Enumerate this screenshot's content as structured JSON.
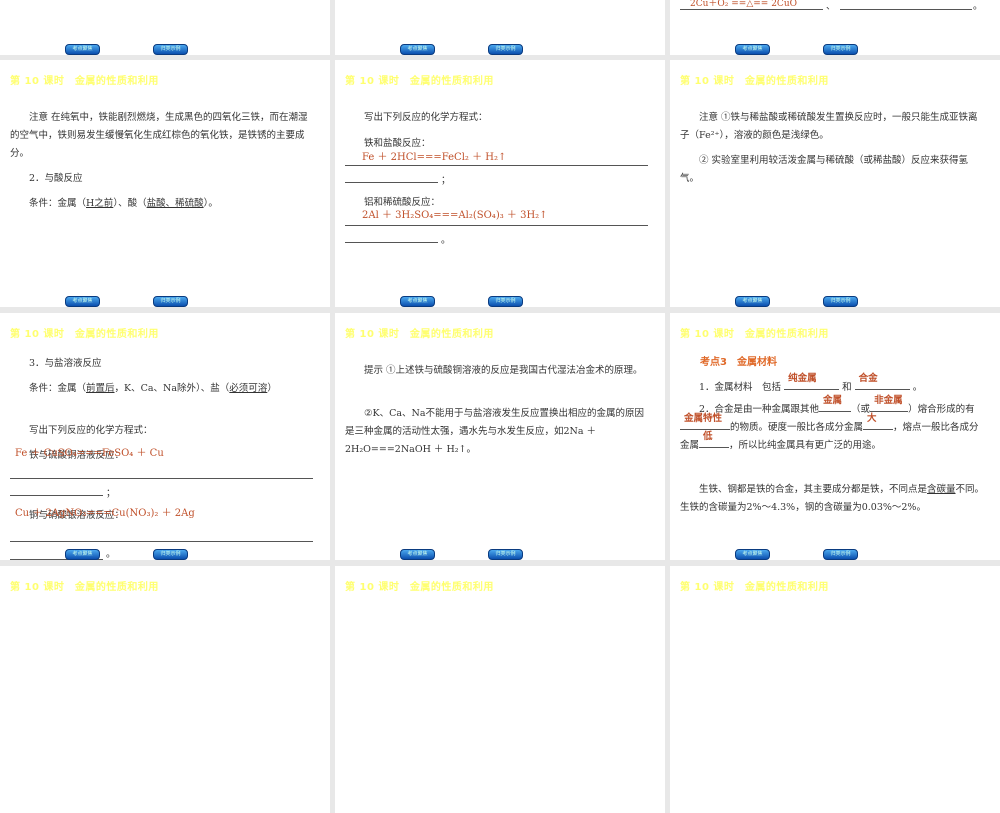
{
  "slide_title": "第 10 课时　金属的性质和利用",
  "nav": {
    "prev_label": "考点聚焦",
    "next_label": "归类示例"
  },
  "s0": {
    "answer": "2Cu＋O₂ ==△== 2CuO",
    "sep": "、",
    "end": "。"
  },
  "s1": {
    "p1": "注意 在纯氧中，铁能剧烈燃烧，生成黑色的四氧化三铁，而在潮湿的空气中，铁则易发生缓慢氧化生成红棕色的氧化铁，是铁锈的主要成分。",
    "h": "2．与酸反应",
    "cond_a": "条件：金属（",
    "cond_b": "H之前",
    "cond_c": "）、酸（",
    "cond_d": "盐酸、稀硫酸",
    "cond_e": "）。"
  },
  "s2": {
    "intro": "写出下列反应的化学方程式：",
    "q1": "铁和盐酸反应：",
    "a1": "Fe ＋ 2HCl===FeCl₂ ＋ H₂↑",
    "q2": "铝和稀硫酸反应：",
    "a2": "2Al ＋ 3H₂SO₄===Al₂(SO₄)₃ ＋ 3H₂↑",
    "semi": "；",
    "end": "。"
  },
  "s3": {
    "p1": "注意 ①铁与稀盐酸或稀硫酸发生置换反应时，一般只能生成亚铁离子（Fe²⁺），溶液的颜色是浅绿色。",
    "p2": "② 实验室里利用较活泼金属与稀硫酸（或稀盐酸）反应来获得氢气。"
  },
  "s4": {
    "h": "3．与盐溶液反应",
    "cond_a": "条件：金属（",
    "cond_b": "前置后",
    "cond_c": "，K、Ca、Na除外）、盐（",
    "cond_d": "必须可溶",
    "cond_e": "）",
    "intro": "写出下列反应的化学方程式：",
    "q1": "铁与硫酸铜溶液反应：",
    "a1": "Fe ＋ CuSO₄===FeSO₄ ＋ Cu",
    "q2": "铜与硝酸银溶液反应：",
    "a2": "Cu ＋ 2AgNO₃===Cu(NO₃)₂ ＋ 2Ag",
    "semi": "；",
    "end": "。"
  },
  "s5": {
    "p1": "提示 ①上述铁与硫酸铜溶液的反应是我国古代湿法冶金术的原理。",
    "p2": "②K、Ca、Na不能用于与盐溶液发生反应置换出相应的金属的原因是三种金属的活动性太强，遇水先与水发生反应，如2Na ＋ 2H₂O===2NaOH ＋ H₂↑。"
  },
  "s6": {
    "kd": "考点3　金属材料",
    "l1a": "1．金属材料　包括",
    "l1_ans1": "纯金属",
    "l1b": "和",
    "l1_ans2": "合金",
    "l1c": "。",
    "l2a": "2．合金是由一种金属跟其他",
    "l2_ans1": "金属",
    "l2b": "（或",
    "l2_ans2": "非金属",
    "l2c": "）熔合形成的有",
    "l2_ans3": "金属特性",
    "l2d": "的物质。硬度一般比各成分金属",
    "l2_ans4": "大",
    "l2e": "，熔点一般比各成分金属",
    "l2_ans5": "低",
    "l2f": "，所以比纯金属具有更广泛的用途。",
    "l3a": "生铁、钢都是铁的合金，其主要成分都是铁，不同点是",
    "l3_u": "含碳量",
    "l3b": "不同。生铁的含碳量为2%～4.3%，钢的含碳量为0.03%～2%。"
  }
}
